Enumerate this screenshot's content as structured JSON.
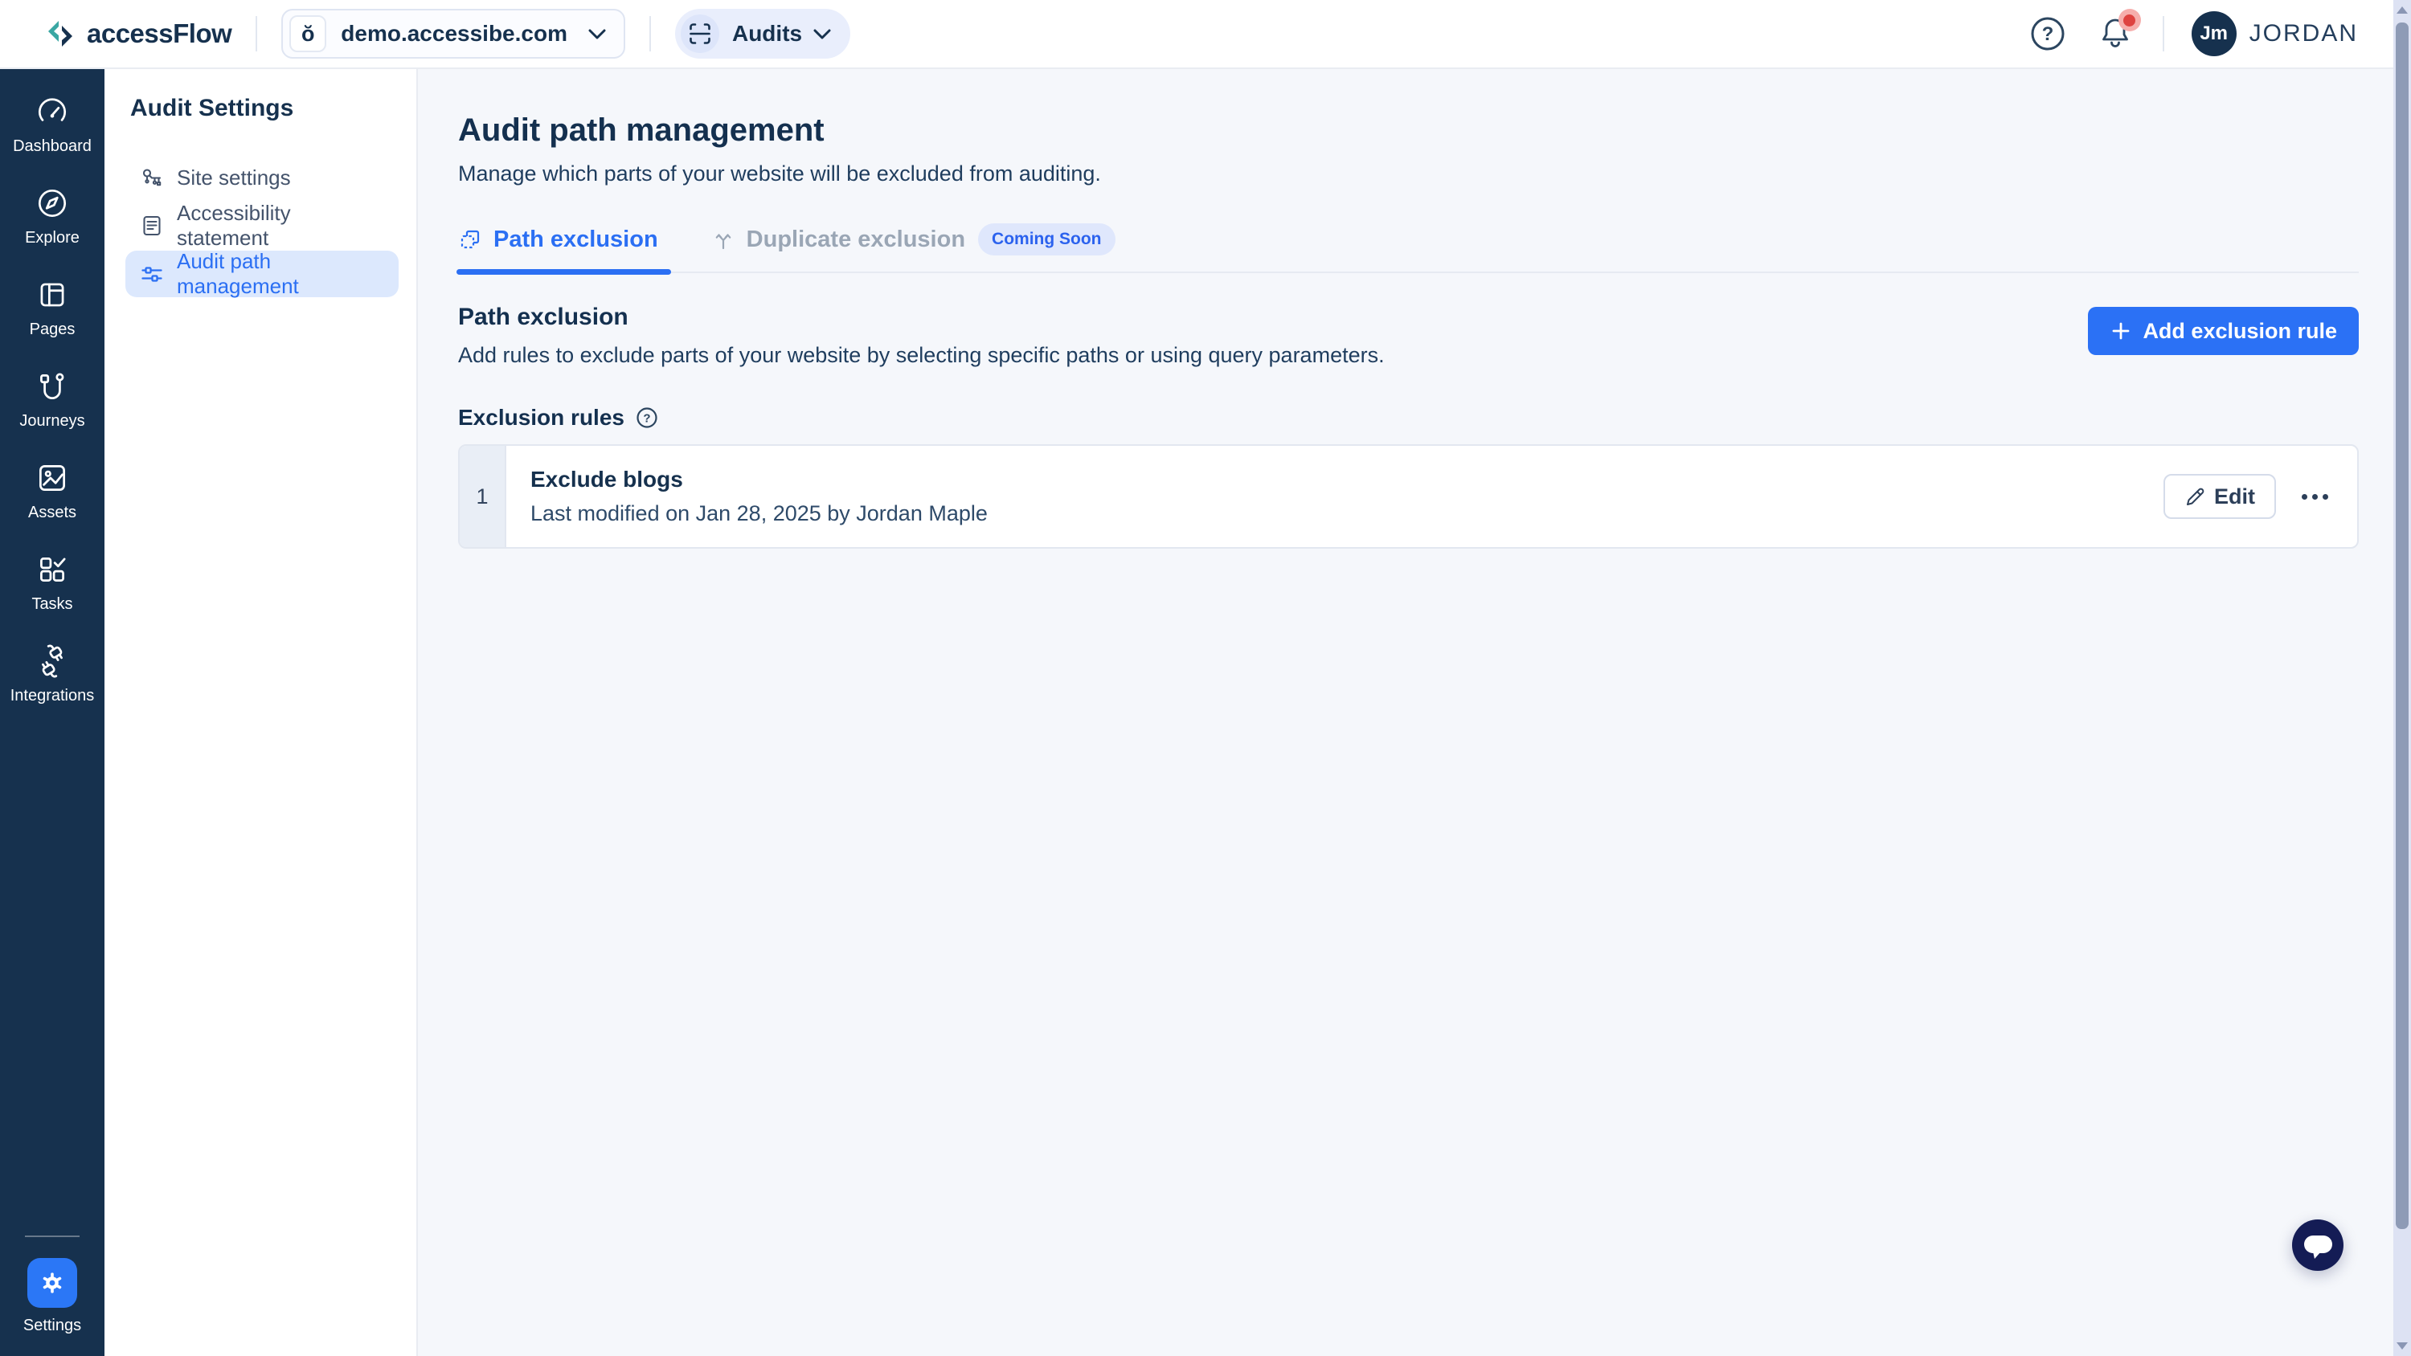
{
  "app": {
    "brand": "accessFlow"
  },
  "header": {
    "site_selector": {
      "favicon_glyph": "ŏ",
      "value": "demo.accessibe.com"
    },
    "audits_selector": {
      "label": "Audits"
    },
    "user": {
      "initials": "Jm",
      "name": "JORDAN"
    }
  },
  "sidebar": {
    "items": [
      {
        "label": "Dashboard",
        "icon": "dashboard-gauge-icon"
      },
      {
        "label": "Explore",
        "icon": "explore-compass-icon"
      },
      {
        "label": "Pages",
        "icon": "pages-layout-icon"
      },
      {
        "label": "Journeys",
        "icon": "journeys-route-icon"
      },
      {
        "label": "Assets",
        "icon": "assets-image-icon"
      },
      {
        "label": "Tasks",
        "icon": "tasks-check-icon"
      },
      {
        "label": "Integrations",
        "icon": "integrations-plug-icon"
      }
    ],
    "settings": {
      "label": "Settings",
      "icon": "gear-icon"
    }
  },
  "settings_nav": {
    "title": "Audit Settings",
    "items": [
      {
        "label": "Site settings",
        "icon": "key-icon",
        "active": false
      },
      {
        "label": "Accessibility statement",
        "icon": "document-icon",
        "active": false
      },
      {
        "label": "Audit path management",
        "icon": "sliders-icon",
        "active": true
      }
    ]
  },
  "main": {
    "title": "Audit path management",
    "subtitle": "Manage which parts of your website will be excluded from auditing.",
    "tabs": [
      {
        "label": "Path exclusion",
        "active": true
      },
      {
        "label": "Duplicate exclusion",
        "active": false,
        "badge": "Coming Soon"
      }
    ],
    "path_exclusion": {
      "title": "Path exclusion",
      "description": "Add rules to exclude parts of your website by selecting specific paths or using query parameters.",
      "add_button_label": "Add exclusion rule",
      "rules_heading": "Exclusion rules",
      "rules": [
        {
          "index": "1",
          "name": "Exclude blogs",
          "meta": "Last modified on Jan 28, 2025 by Jordan Maple",
          "edit_label": "Edit"
        }
      ]
    }
  },
  "colors": {
    "accent_blue": "#2b6ff3",
    "navy": "#16314e",
    "active_item_bg": "#dce8fd",
    "badge_bg": "#dfe7fc",
    "main_bg": "#f5f7fb",
    "chat_bg": "#141c55",
    "notification_red": "#de4340",
    "teal_logo": "#3aa7a3"
  }
}
